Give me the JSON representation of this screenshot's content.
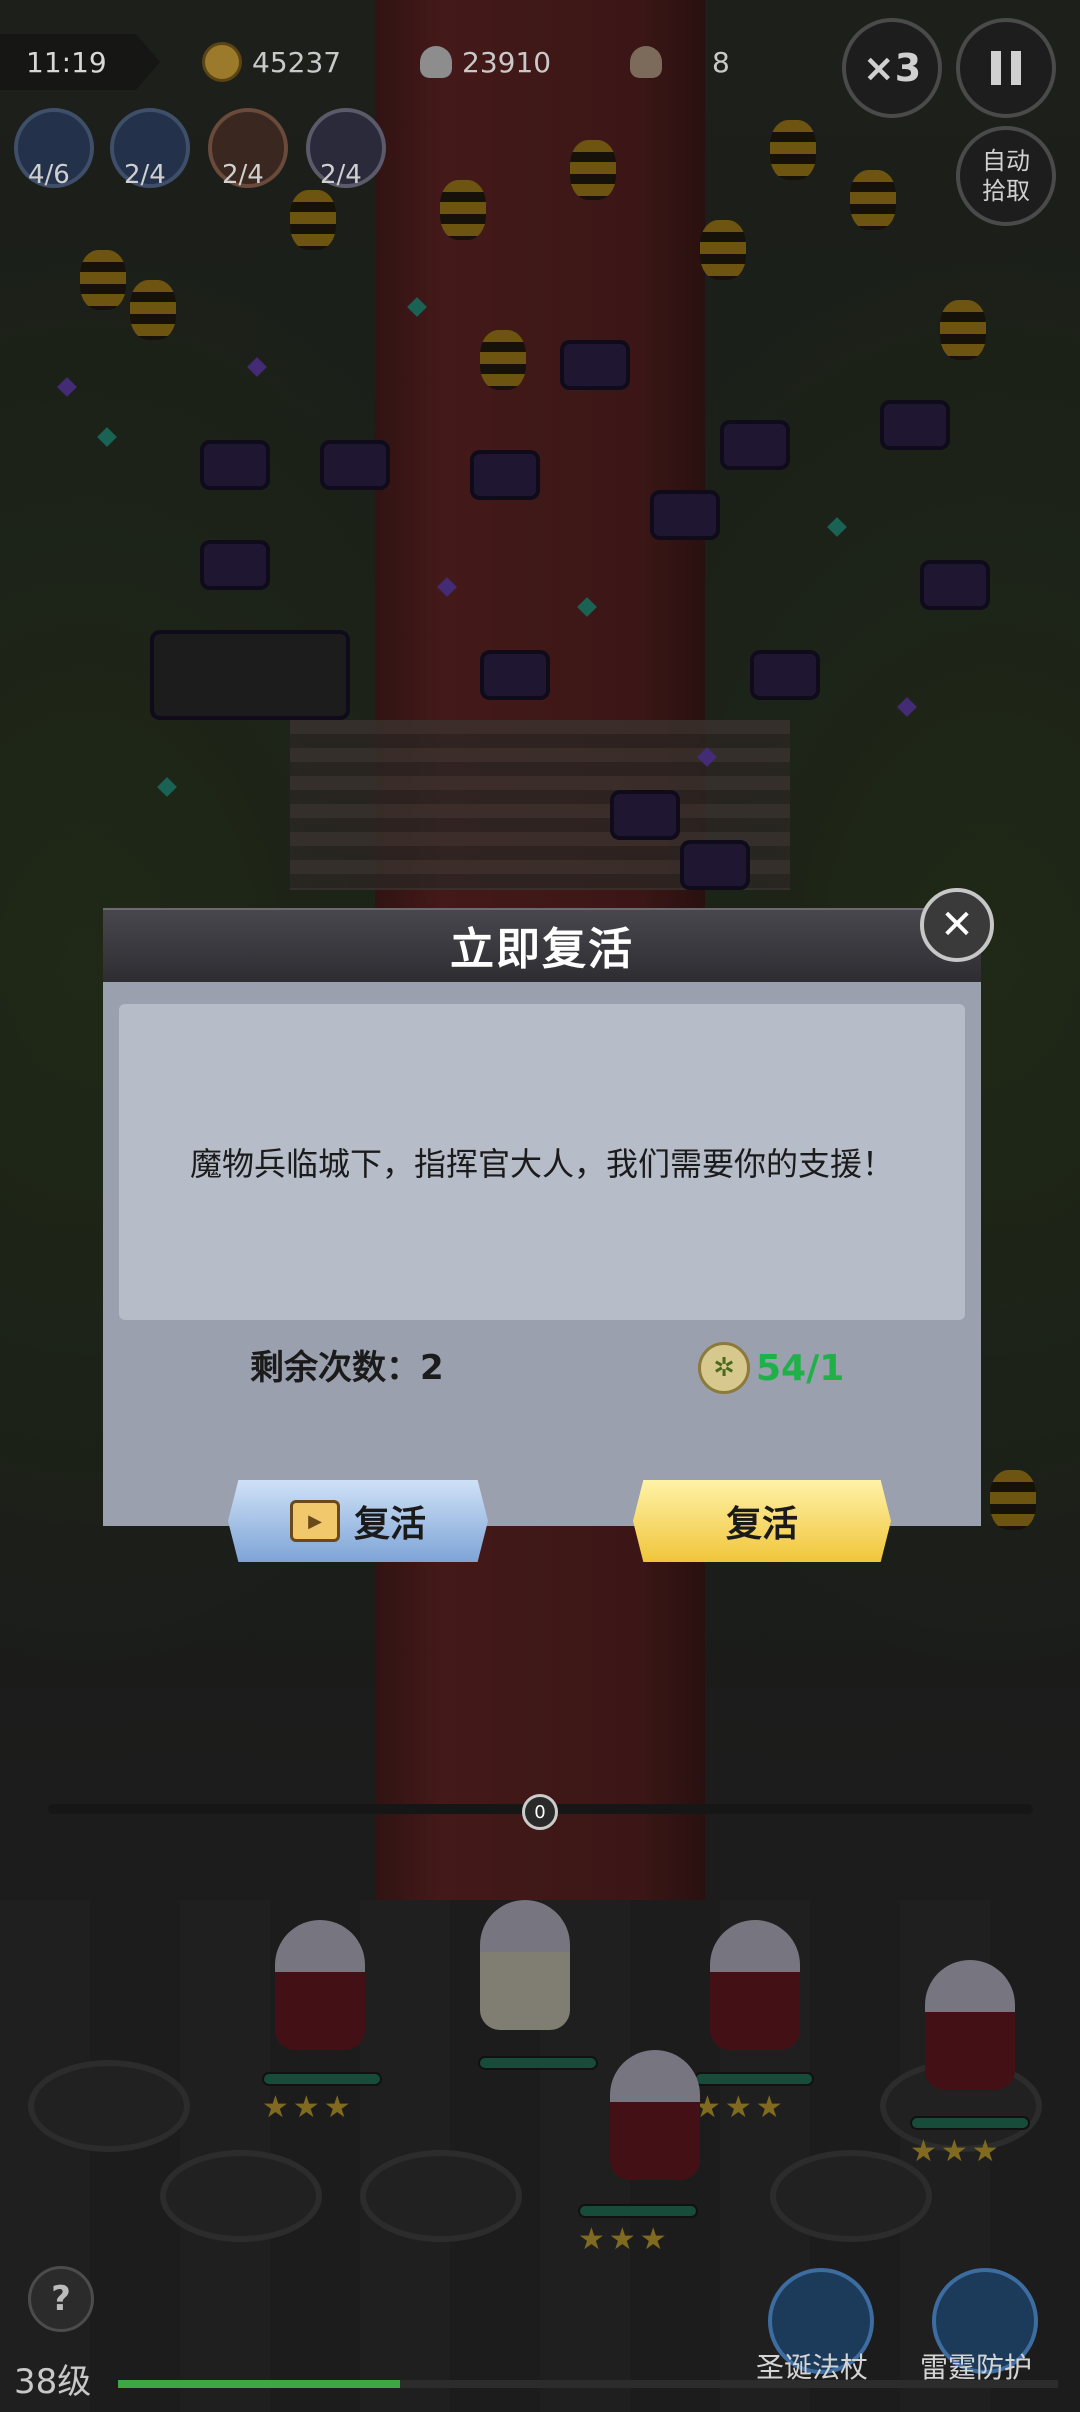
{
  "hud": {
    "clock": "11:19",
    "coins": "45237",
    "kills": "23910",
    "wave": "8",
    "speed": "×3",
    "auto_pickup": "自动\n拾取",
    "skills": [
      {
        "icon": "axe-skill-icon",
        "count": "4/6"
      },
      {
        "icon": "wand-skill-icon",
        "count": "2/4"
      },
      {
        "icon": "swirl-skill-icon",
        "count": "2/4"
      },
      {
        "icon": "target-skill-icon",
        "count": "2/4"
      }
    ]
  },
  "dialog": {
    "title": "立即复活",
    "message": "魔物兵临城下，指挥官大人，我们需要你的支援！",
    "remaining": "剩余次数：2",
    "cost": "54/1",
    "ad_revive_label": "复活",
    "gold_revive_label": "复活"
  },
  "battle": {
    "slider_value": "0"
  },
  "bottom": {
    "level": "38级",
    "xp_progress": 0.3,
    "help": "?",
    "skill_left_label": "圣诞法杖",
    "skill_right_label": "雷霆防护"
  },
  "colors": {
    "cost_green": "#1fb04a",
    "gold_button": "#f0c53a",
    "blue_button": "#7ea4d6"
  }
}
